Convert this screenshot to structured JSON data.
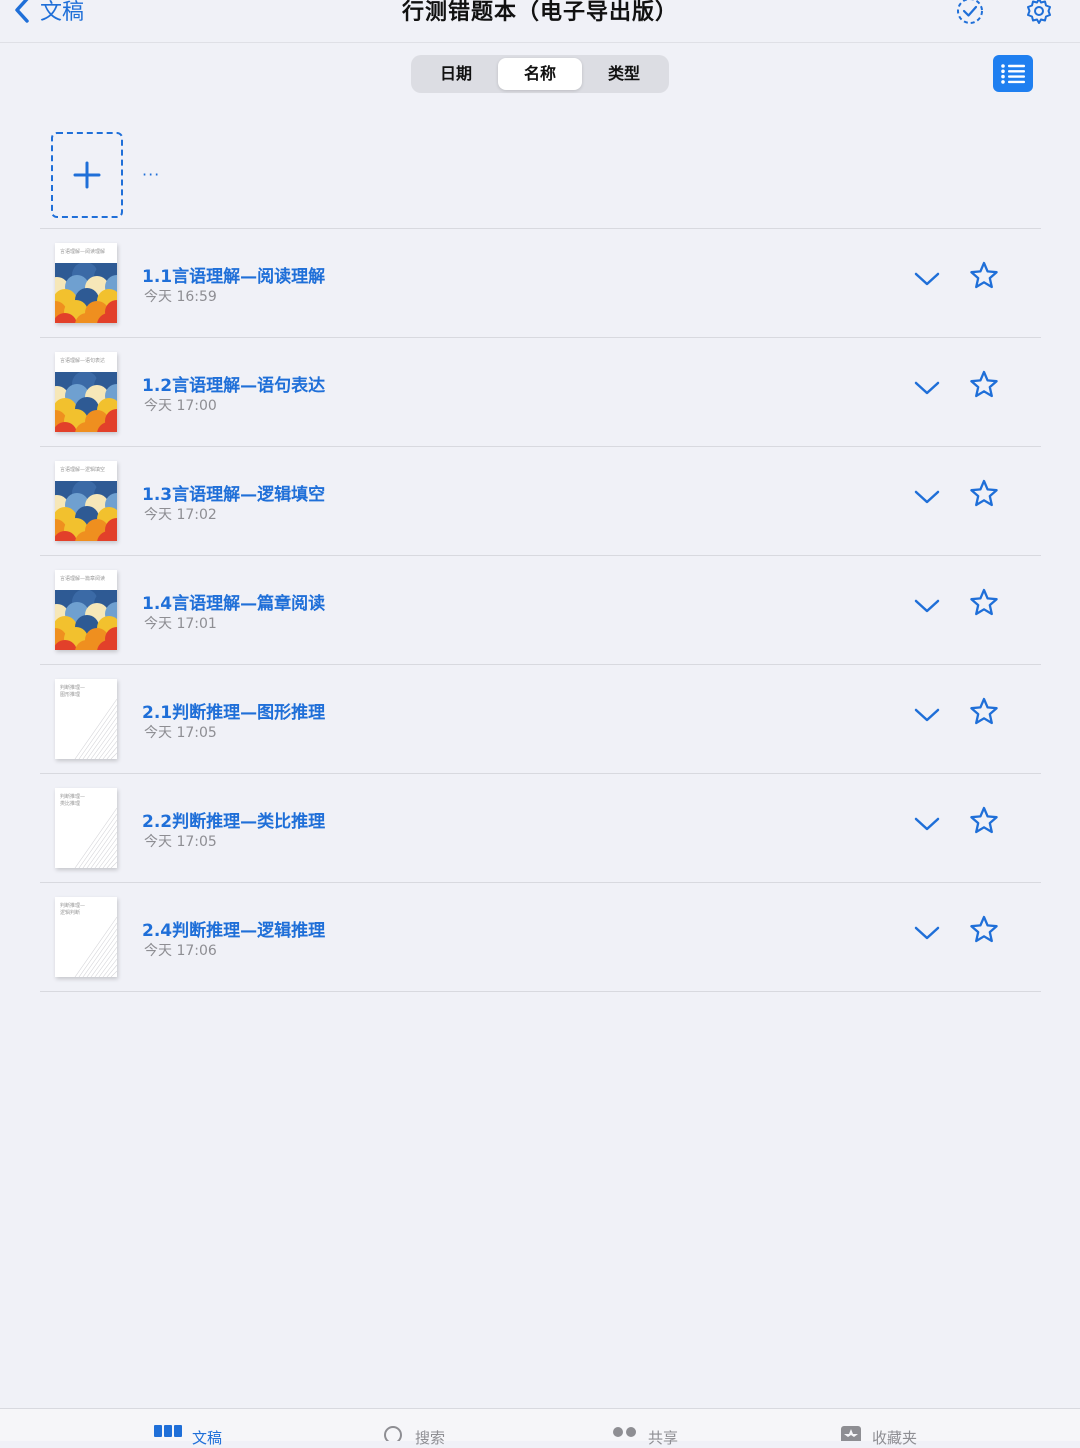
{
  "header": {
    "back_label": "文稿",
    "title": "行测错题本（电子导出版）"
  },
  "sort": {
    "options": [
      "日期",
      "名称",
      "类型"
    ],
    "selected": "名称"
  },
  "new_doc": {
    "more_label": "···"
  },
  "documents": [
    {
      "title": "1.1言语理解—阅读理解",
      "time": "今天 16:59",
      "cover": "言语理解—阅读理解"
    },
    {
      "title": "1.2言语理解—语句表达",
      "time": "今天 17:00",
      "cover": "言语理解—语句表达"
    },
    {
      "title": "1.3言语理解—逻辑填空",
      "time": "今天 17:02",
      "cover": "言语理解—逻辑填空"
    },
    {
      "title": "1.4言语理解—篇章阅读",
      "time": "今天 17:01",
      "cover": "言语理解—篇章阅读"
    },
    {
      "title": "2.1判断推理—图形推理",
      "time": "今天 17:05",
      "cover": "判断推理— 图形推理"
    },
    {
      "title": "2.2判断推理—类比推理",
      "time": "今天 17:05",
      "cover": "判断推理— 类比推理"
    },
    {
      "title": "2.4判断推理—逻辑推理",
      "time": "今天 17:06",
      "cover": "判断推理— 逻辑判断"
    }
  ],
  "tabbar": {
    "tabs": [
      {
        "label": "文稿",
        "icon": "grid-icon",
        "active": true
      },
      {
        "label": "搜索",
        "icon": "search-icon",
        "active": false
      },
      {
        "label": "共享",
        "icon": "people-icon",
        "active": false
      },
      {
        "label": "收藏夹",
        "icon": "star-box-icon",
        "active": false
      }
    ]
  },
  "colors": {
    "accent": "#1f6fd8",
    "background": "#f0f1f7",
    "wave_blue": "#2e5a94",
    "wave_light": "#6fa0d0",
    "wave_cream": "#f6e7b8",
    "wave_yellow": "#f2c12e",
    "wave_orange": "#ef8f1f",
    "wave_red": "#e2402a"
  }
}
